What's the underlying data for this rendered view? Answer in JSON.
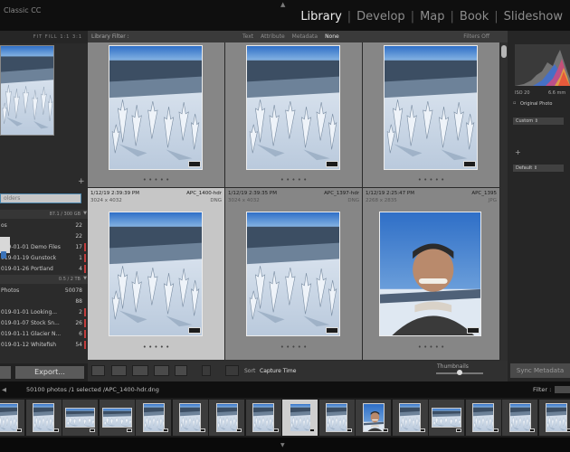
{
  "app": {
    "title": "Classic CC"
  },
  "modules": [
    "Library",
    "Develop",
    "Map",
    "Book",
    "Slideshow"
  ],
  "active_module": "Library",
  "navigator": {
    "fit_options": [
      "FIT",
      "FILL",
      "1:1",
      "3:1"
    ]
  },
  "folders": {
    "search_placeholder": "olders",
    "volume1": {
      "usage": "87.1 / 300 GB"
    },
    "volume1_rows": [
      {
        "name": "os",
        "count": "22",
        "flag": false
      },
      {
        "name": "",
        "count": "22",
        "flag": false
      },
      {
        "name": "019-01-01 Demo Files",
        "count": "17",
        "flag": true
      },
      {
        "name": "019-01-19 Gunstock",
        "count": "1",
        "flag": true
      },
      {
        "name": "019-01-26 Portland",
        "count": "4",
        "flag": true
      }
    ],
    "volume2": {
      "usage": "0.5 / 2 TB"
    },
    "volume2_rows": [
      {
        "name": "Photos",
        "count": "50078",
        "flag": false
      },
      {
        "name": "",
        "count": "88",
        "flag": false
      },
      {
        "name": "019-01-01 Looking...",
        "count": "2",
        "flag": true
      },
      {
        "name": "019-01-07 Stock Sn...",
        "count": "26",
        "flag": true
      },
      {
        "name": "019-01-11 Glacier N...",
        "count": "6",
        "flag": true
      },
      {
        "name": "019-01-12 Whitefish",
        "count": "54",
        "flag": true
      }
    ],
    "export_label": "Export..."
  },
  "library_filter": {
    "label": "Library Filter :",
    "options": [
      "Text",
      "Attribute",
      "Metadata",
      "None"
    ],
    "active": "None",
    "status": "Filters Off"
  },
  "grid": {
    "row2": [
      {
        "date": "1/12/19 2:39:39 PM",
        "file": "APC_1400-hdr",
        "dims": "3024 x 4032",
        "type": "DNG",
        "selected": true
      },
      {
        "date": "1/12/19 2:39:35 PM",
        "file": "APC_1397-hdr",
        "dims": "3024 x 4032",
        "type": "DNG",
        "selected": false
      },
      {
        "date": "1/12/19 2:25:47 PM",
        "file": "APC_1395",
        "dims": "2268 x 2835",
        "type": "JPG",
        "selected": false
      }
    ]
  },
  "toolbar": {
    "sort_label": "Sort",
    "sort_value": "Capture Time",
    "thumbnails_label": "Thumbnails",
    "thumbnail_size": 0.5
  },
  "right_panel": {
    "iso": "ISO 20",
    "focal": "6.6 mm",
    "original_photo": "Original Photo",
    "preset1": "Custom",
    "preset2": "Default",
    "sync_label": "Sync Metadata"
  },
  "filmstrip": {
    "path_info": "50100 photos /1 selected /APC_1400-hdr.dng",
    "filter_label": "Filter :",
    "thumbs": [
      "snow",
      "snow",
      "wide",
      "wide",
      "snow",
      "snow",
      "snow",
      "snow",
      "selected",
      "snow",
      "portrait",
      "snow",
      "wide",
      "snow",
      "snow",
      "snow"
    ]
  },
  "colors": {
    "flag_red": "#c23d3d",
    "selection_gray": "#c6c6c6",
    "accent_blue": "#3a72b8"
  }
}
